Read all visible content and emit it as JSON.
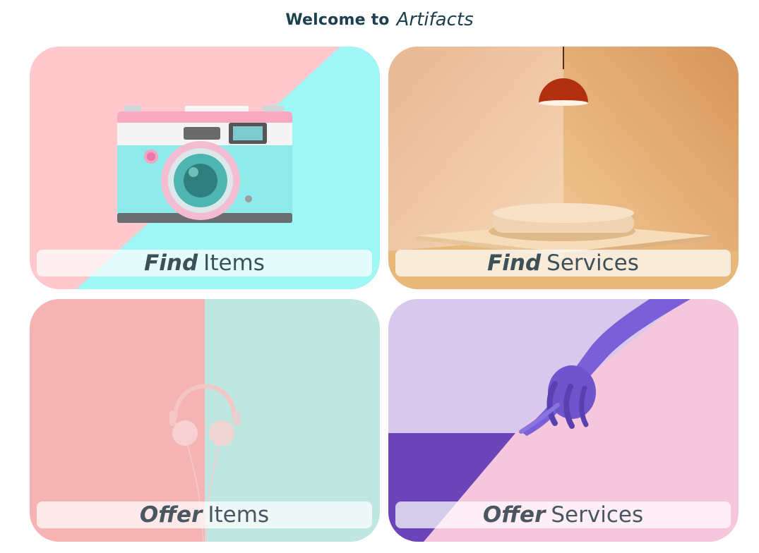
{
  "header": {
    "welcome": "Welcome to",
    "brand": "Artifacts"
  },
  "cards": [
    {
      "verb": "Find",
      "noun": "Items",
      "image": "pastel-camera-icon"
    },
    {
      "verb": "Find",
      "noun": "Services",
      "image": "pendant-lamp-podium-icon"
    },
    {
      "verb": "Offer",
      "noun": "Items",
      "image": "headphones-icon"
    },
    {
      "verb": "Offer",
      "noun": "Services",
      "image": "pointing-hand-icon"
    }
  ],
  "colors": {
    "title": "#1c4050",
    "label_text": "#4a5660",
    "pink": "#ffc6c8",
    "aqua": "#9ef6f2",
    "peach": "#f0c08e",
    "lavender": "#d8c8ec",
    "purple": "#6a44b8"
  }
}
